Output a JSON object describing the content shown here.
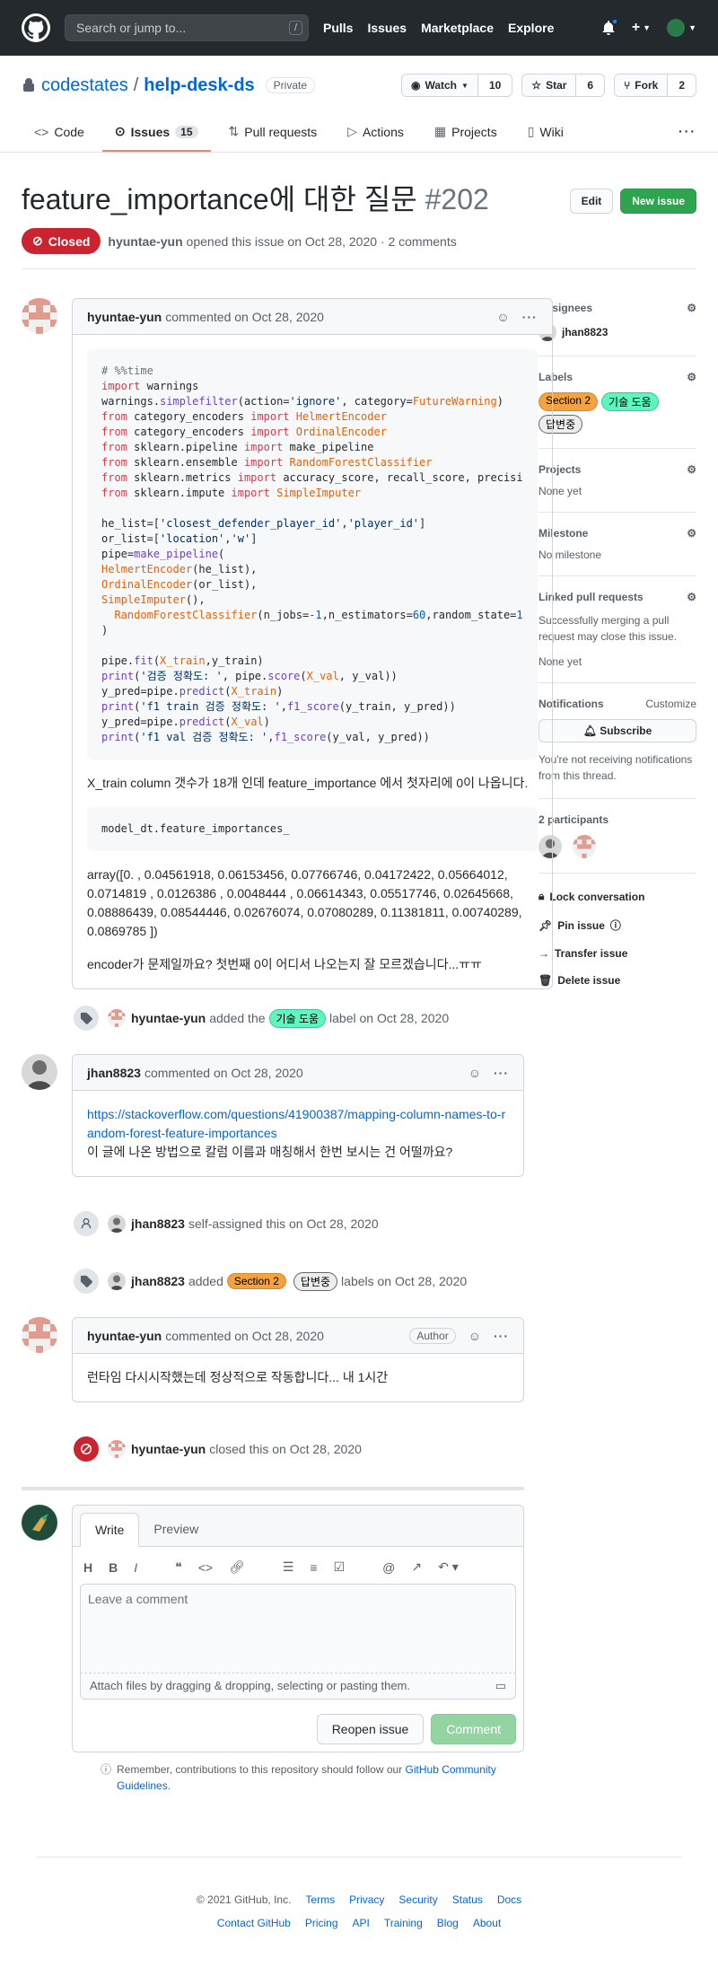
{
  "header": {
    "search_placeholder": "Search or jump to...",
    "search_key": "/",
    "nav": [
      "Pulls",
      "Issues",
      "Marketplace",
      "Explore"
    ]
  },
  "repo": {
    "owner": "codestates",
    "name": "help-desk-ds",
    "visibility": "Private",
    "watch_label": "Watch",
    "watch_count": "10",
    "star_label": "Star",
    "star_count": "6",
    "fork_label": "Fork",
    "fork_count": "2",
    "tabs": [
      {
        "label": "Code"
      },
      {
        "label": "Issues",
        "count": "15"
      },
      {
        "label": "Pull requests"
      },
      {
        "label": "Actions"
      },
      {
        "label": "Projects"
      },
      {
        "label": "Wiki"
      }
    ]
  },
  "issue": {
    "title": "feature_importance에 대한 질문",
    "number": "#202",
    "edit_label": "Edit",
    "new_issue_label": "New issue",
    "state": "Closed",
    "author": "hyuntae-yun",
    "meta_text": "opened this issue on Oct 28, 2020 · 2 comments"
  },
  "comments": {
    "first": {
      "author": "hyuntae-yun",
      "when": "commented on Oct 28, 2020",
      "text1": "X_train column 갯수가 18개 인데 feature_importance 에서 첫자리에 0이 나옵니다.",
      "code2": "model_dt.feature_importances_",
      "array_text": "array([0. , 0.04561918, 0.06153456, 0.07766746, 0.04172422, 0.05664012, 0.0714819 , 0.0126386 , 0.0048444 , 0.06614343, 0.05517746, 0.02645668, 0.08886439, 0.08544446, 0.02676074, 0.07080289, 0.11381811, 0.00740289, 0.0869785 ])",
      "text2": "encoder가 문제일까요? 첫번째 0이 어디서 나오는지 잘 모르겠습니다...ㅠㅠ"
    },
    "second": {
      "author": "jhan8823",
      "when": "commented on Oct 28, 2020",
      "link": "https://stackoverflow.com/questions/41900387/mapping-column-names-to-random-forest-feature-importances",
      "text": "이 글에 나온 방법으로 칼럼 이름과 매칭해서 한번 보시는 건 어떨까요?"
    },
    "third": {
      "author": "hyuntae-yun",
      "when": "commented on Oct 28, 2020",
      "author_badge": "Author",
      "text": "런타임 다시시작했는데 정상적으로 작동합니다... 내 1시간"
    }
  },
  "events": {
    "label_added": {
      "actor": "hyuntae-yun",
      "pre": "added the",
      "label": "기술 도움",
      "post": "label on Oct 28, 2020"
    },
    "self_assigned": {
      "actor": "jhan8823",
      "text": "self-assigned this on Oct 28, 2020"
    },
    "labels_added": {
      "actor": "jhan8823",
      "pre": "added",
      "label1": "Section 2",
      "label2": "답변중",
      "post": "labels on Oct 28, 2020"
    },
    "closed": {
      "actor": "hyuntae-yun",
      "text": "closed this on Oct 28, 2020"
    }
  },
  "composer": {
    "tab_write": "Write",
    "tab_preview": "Preview",
    "placeholder": "Leave a comment",
    "attach_text": "Attach files by dragging & dropping, selecting or pasting them.",
    "reopen_label": "Reopen issue",
    "comment_label": "Comment",
    "reminder_pre": "Remember, contributions to this repository should follow our",
    "reminder_link": "GitHub Community Guidelines",
    "reminder_post": "."
  },
  "sidebar": {
    "assignees_title": "Assignees",
    "assignee": "jhan8823",
    "labels_title": "Labels",
    "labels": [
      "Section 2",
      "기술 도움",
      "답변중"
    ],
    "projects_title": "Projects",
    "projects_value": "None yet",
    "milestone_title": "Milestone",
    "milestone_value": "No milestone",
    "linked_title": "Linked pull requests",
    "linked_desc": "Successfully merging a pull request may close this issue.",
    "linked_value": "None yet",
    "notifications_title": "Notifications",
    "customize": "Customize",
    "subscribe": "Subscribe",
    "notif_desc": "You're not receiving notifications from this thread.",
    "participants_title": "2 participants",
    "lock": "Lock conversation",
    "pin": "Pin issue",
    "transfer": "Transfer issue",
    "delete": "Delete issue"
  },
  "footer": {
    "copyright": "© 2021 GitHub, Inc.",
    "row1": [
      "Terms",
      "Privacy",
      "Security",
      "Status",
      "Docs"
    ],
    "row2": [
      "Contact GitHub",
      "Pricing",
      "API",
      "Training",
      "Blog",
      "About"
    ]
  },
  "colors": {
    "header_bg": "#24292e",
    "closed_red": "#cb2431",
    "green": "#2ea44f",
    "link": "#0366d6"
  }
}
